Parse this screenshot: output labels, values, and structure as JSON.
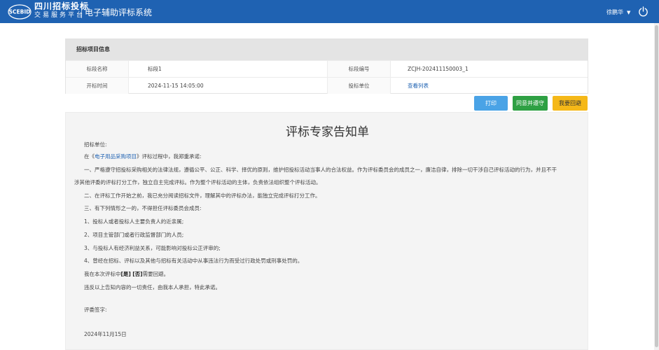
{
  "header": {
    "logo_text": "SCEBID",
    "brand_line1": "四川招标投标",
    "brand_line2": "交易服务平台",
    "system_title": "电子辅助评标系统",
    "user_name": "徐鹏华",
    "colors": {
      "bar": "#1f62b2"
    }
  },
  "info": {
    "title": "招标项目信息",
    "rows": [
      {
        "label1": "标段名称",
        "value1": "标段1",
        "label2": "标段编号",
        "value2": "ZCJH-202411150003_1"
      },
      {
        "label1": "开标时间",
        "value1": "2024-11-15 14:05:00",
        "label2": "投标单位",
        "value2": "查看列表"
      }
    ]
  },
  "actions": {
    "print": "打印",
    "agree": "同意并遵守",
    "avoid": "我要回避"
  },
  "doc": {
    "title": "评标专家告知单",
    "addressee": "招标单位:",
    "intro_prefix": "在《",
    "project_name": "电子用品采购项目",
    "intro_suffix": "》评标过程中，我郑重承诺:",
    "p1a": "一、严格遵守招投标采购相关的法律法规，遵循公平、公正、科学、择优的原则，维护招投标活动当事人的合法权益。作为评标委员会的成员之一，廉洁自律，排除一切干涉自己评标活动的行为，并且不干",
    "p1b": "涉其他评委的评标打分工作，独立自主完成评标。作为整个评标活动的主体，负责依法组织整个评标活动。",
    "p2": "二、在评标工作开始之前，我已充分阅读招标文件，理解其中的评标办法，能独立完成评标打分工作。",
    "p3": "三、有下列情形之一的，不得担任评标委员会成员:",
    "items": [
      "1、投标人或者投标人主要负责人的近亲属;",
      "2、项目主管部门或者行政监督部门的人员;",
      "3、与投标人有经济利益关系，可能影响对投标公正评审的;",
      "4、曾经在招标、评标以及其他与招标有关活动中从事违法行为而受过行政处罚或刑事处罚的。"
    ],
    "avoid_prefix": "我在本次评标中",
    "avoid_yes": "[是]",
    "avoid_no": "[否]",
    "avoid_suffix": "需要回避。",
    "responsibility": "违反以上告知内容的一切责任，由我本人承担，特此承诺。",
    "signature_label": "评委签字:",
    "date": "2024年11月15日"
  }
}
